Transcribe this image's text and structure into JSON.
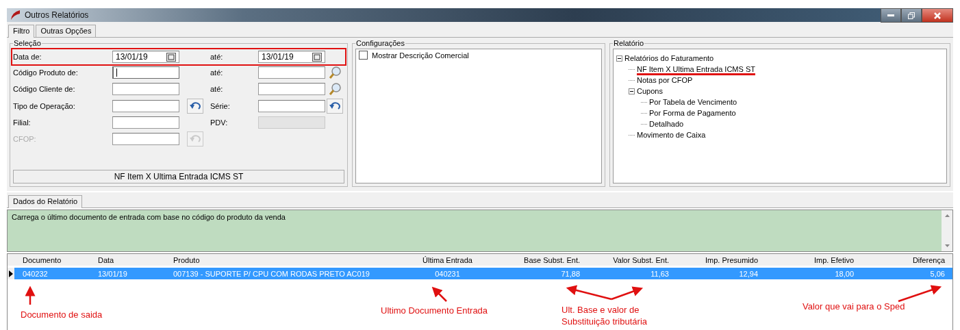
{
  "window": {
    "title": "Outros Relatórios"
  },
  "tabs": [
    {
      "label": "Filtro",
      "selected": true
    },
    {
      "label": "Outras Opções",
      "selected": false
    }
  ],
  "selection": {
    "title": "Seleção",
    "rows": [
      {
        "label": "Data de:",
        "disabled": false,
        "highlighted": true,
        "field": {
          "value": "13/01/19",
          "kind": "date",
          "disabled": false
        },
        "to_label": "até:",
        "to_field": {
          "value": "13/01/19",
          "kind": "date",
          "disabled": false
        }
      },
      {
        "label": "Código Produto de:",
        "disabled": false,
        "highlighted": false,
        "field": {
          "kind": "text",
          "focused": true,
          "disabled": false
        },
        "to_label": "até:",
        "to_field": {
          "kind": "text",
          "focused": false,
          "disabled": false
        },
        "to_button": {
          "kind": "search",
          "disabled": false
        }
      },
      {
        "label": "Código Cliente de:",
        "disabled": false,
        "highlighted": false,
        "field": {
          "kind": "text",
          "focused": false,
          "disabled": false
        },
        "to_label": "até:",
        "to_field": {
          "kind": "text",
          "focused": false,
          "disabled": false
        },
        "to_button": {
          "kind": "search",
          "disabled": false
        }
      },
      {
        "label": "Tipo de Operação:",
        "disabled": false,
        "highlighted": false,
        "field": {
          "kind": "text",
          "focused": false,
          "disabled": false
        },
        "button": {
          "kind": "undo",
          "disabled": false
        },
        "to_label": "Série:",
        "to_field": {
          "kind": "text",
          "focused": false,
          "disabled": false
        },
        "to_button": {
          "kind": "undo",
          "disabled": false
        }
      },
      {
        "label": "Filial:",
        "disabled": false,
        "highlighted": false,
        "field": {
          "kind": "text",
          "focused": false,
          "disabled": false
        },
        "to_label": "PDV:",
        "to_field": {
          "kind": "text",
          "focused": false,
          "disabled": true
        }
      },
      {
        "label": "CFOP:",
        "disabled": true,
        "highlighted": false,
        "field": {
          "kind": "text",
          "focused": false,
          "disabled": false
        },
        "button": {
          "kind": "undo",
          "disabled": true
        }
      }
    ],
    "status": "NF Item X Ultima Entrada ICMS ST"
  },
  "configuracoes": {
    "title": "Configurações",
    "options": [
      {
        "label": "Mostrar Descrição Comercial",
        "checked": false
      }
    ]
  },
  "relatorio": {
    "title": "Relatório",
    "tree": [
      {
        "label": "Relatórios do Faturamento",
        "expanded": true,
        "underlined": false,
        "children": [
          {
            "label": "NF Item X Ultima Entrada ICMS ST",
            "underlined": true
          },
          {
            "label": "Notas por CFOP",
            "underlined": false
          },
          {
            "label": "Cupons",
            "expanded": true,
            "underlined": false,
            "children": [
              {
                "label": "Por Tabela de Vencimento",
                "underlined": false
              },
              {
                "label": "Por Forma de Pagamento",
                "underlined": false
              },
              {
                "label": "Detalhado",
                "underlined": false
              }
            ]
          },
          {
            "label": "Movimento de Caixa",
            "underlined": false
          }
        ]
      }
    ]
  },
  "data_tabs": [
    {
      "label": "Dados do Relatório",
      "selected": true
    }
  ],
  "description": "Carrega o último documento de entrada com base no código do produto da venda",
  "table": {
    "columns": [
      "Documento",
      "Data",
      "Produto",
      "Última Entrada",
      "Base Subst. Ent.",
      "Valor Subst. Ent.",
      "Imp. Presumido",
      "Imp. Efetivo",
      "Diferença"
    ],
    "rows": [
      {
        "selected": true,
        "cells": [
          "040232",
          "13/01/19",
          "007139 - SUPORTE P/ CPU COM RODAS PRETO AC019",
          "040231",
          "71,88",
          "11,63",
          "12,94",
          "18,00",
          "5,06"
        ]
      }
    ]
  },
  "annotations": [
    "Documento de saida",
    "Ultimo Documento Entrada",
    "Ult. Base e valor de Substituição tributária",
    "Valor que vai para o Sped"
  ]
}
